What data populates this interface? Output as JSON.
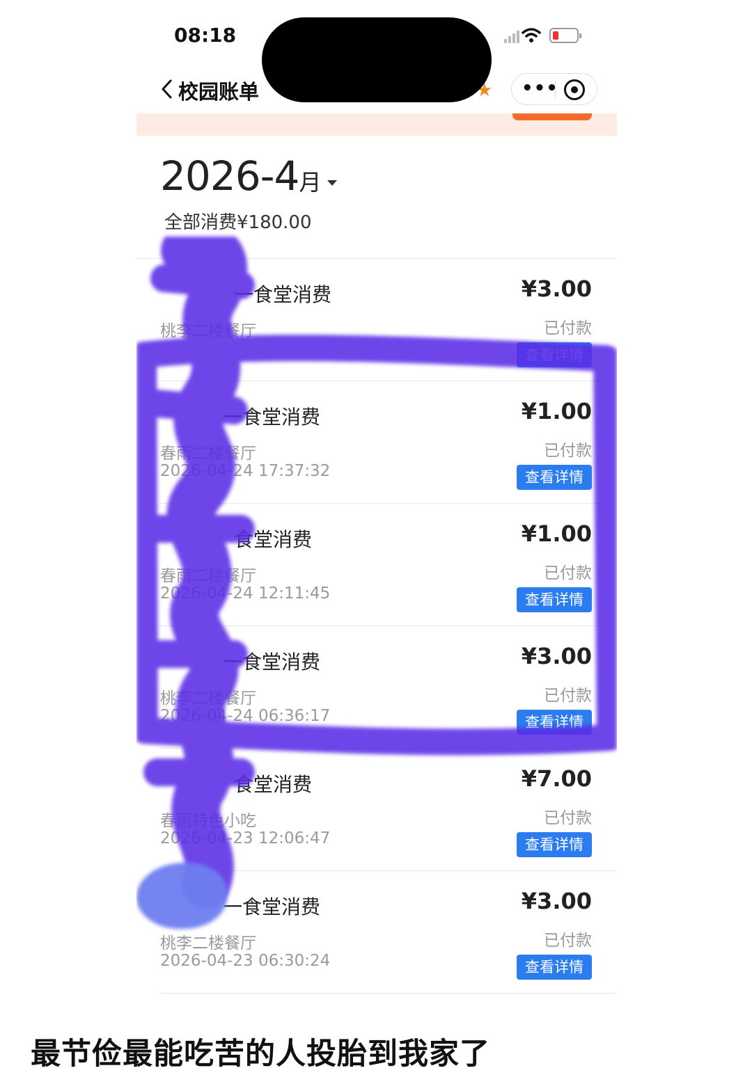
{
  "status_bar": {
    "time": "08:18",
    "icons": [
      "signal-icon",
      "wifi-icon",
      "battery-icon"
    ],
    "battery_color": "#f23030"
  },
  "nav": {
    "back_icon": "chevron-left-icon",
    "title": "校园账单",
    "icons": [
      "star-icon",
      "more-icon",
      "close-mini-program-icon"
    ]
  },
  "summary": {
    "year": "2026-4",
    "month_unit": "月",
    "total_label": "全部消费¥180.00"
  },
  "records": [
    {
      "title": "一食堂消费",
      "place": "桃李二楼餐厅",
      "time": "",
      "amount": "¥3.00",
      "status": "已付款",
      "button": "查看详情"
    },
    {
      "title": "一食堂消费",
      "place": "春雨二楼餐厅",
      "time": "2026-04-24 17:37:32",
      "amount": "¥1.00",
      "status": "已付款",
      "button": "查看详情"
    },
    {
      "title": "食堂消费",
      "place": "春雨二楼餐厅",
      "time": "2026-04-24 12:11:45",
      "amount": "¥1.00",
      "status": "已付款",
      "button": "查看详情"
    },
    {
      "title": "一食堂消费",
      "place": "桃李二楼餐厅",
      "time": "2026-04-24 06:36:17",
      "amount": "¥3.00",
      "status": "已付款",
      "button": "查看详情"
    },
    {
      "title": "食堂消费",
      "place": "春雨特色小吃",
      "time": "2026-04-23 12:06:47",
      "amount": "¥7.00",
      "status": "已付款",
      "button": "查看详情"
    },
    {
      "title": "一食堂消费",
      "place": "桃李二楼餐厅",
      "time": "2026-04-23 06:30:24",
      "amount": "¥3.00",
      "status": "已付款",
      "button": "查看详情"
    }
  ],
  "caption": "最节俭最能吃苦的人投胎到我家了",
  "colors": {
    "accent_blue": "#2b7cef",
    "scribble_purple": "#5a2ce6",
    "scribble_blue": "#6e7ef0",
    "banner_orange": "#f26b2a"
  }
}
